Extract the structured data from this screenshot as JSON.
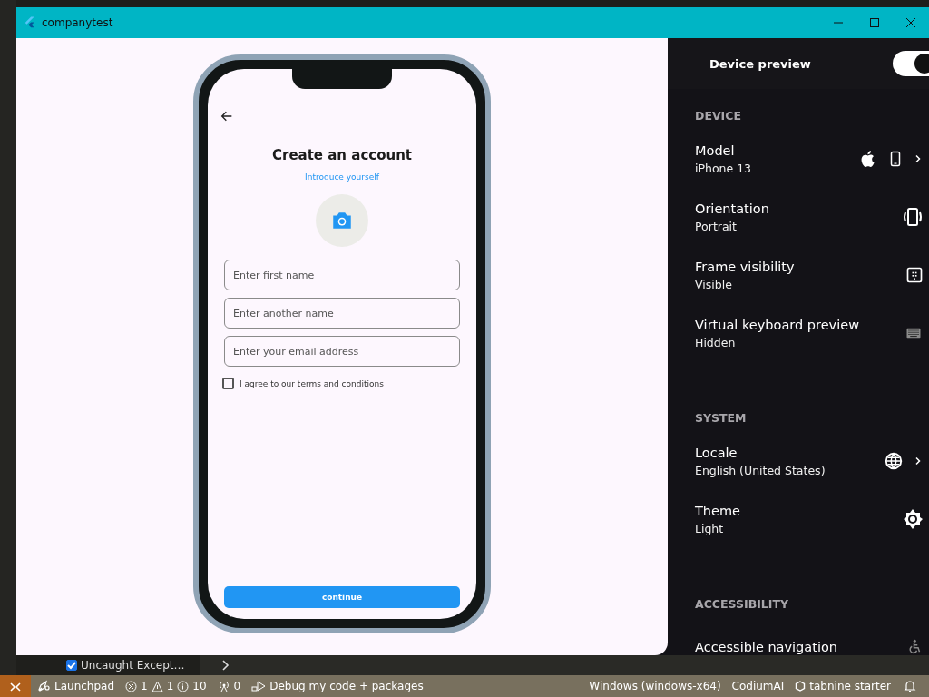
{
  "window": {
    "title": "companytest"
  },
  "phone_screen": {
    "title": "Create an account",
    "subtitle": "Introduce yourself",
    "fields": [
      {
        "placeholder": "Enter first name"
      },
      {
        "placeholder": "Enter another name"
      },
      {
        "placeholder": "Enter your email address"
      }
    ],
    "terms": {
      "label": "I agree to our terms and conditions",
      "checked": false
    },
    "button": "continue"
  },
  "device_preview": {
    "title": "Device preview",
    "toggle": {
      "on": true
    },
    "sections": [
      {
        "heading": "DEVICE",
        "items": [
          {
            "label": "Model",
            "value": "iPhone 13"
          },
          {
            "label": "Orientation",
            "value": "Portrait"
          },
          {
            "label": "Frame visibility",
            "value": "Visible"
          },
          {
            "label": "Virtual keyboard preview",
            "value": "Hidden"
          }
        ]
      },
      {
        "heading": "SYSTEM",
        "items": [
          {
            "label": "Locale",
            "value": "English (United States)"
          },
          {
            "label": "Theme",
            "value": "Light"
          }
        ]
      },
      {
        "heading": "ACCESSIBILITY",
        "items": [
          {
            "label": "Accessible navigation"
          }
        ]
      }
    ]
  },
  "debug_bar": {
    "exception": {
      "label": "Uncaught Except…",
      "checked": true
    }
  },
  "status_bar": {
    "left": [
      {
        "kind": "launchpad",
        "text": "Launchpad"
      },
      {
        "kind": "problems",
        "errors": "1",
        "warnings": "1",
        "info": "10"
      },
      {
        "kind": "ports",
        "text": "0"
      },
      {
        "kind": "debug",
        "text": "Debug my code + packages"
      }
    ],
    "right": [
      {
        "kind": "text",
        "text": "Windows (windows-x64)"
      },
      {
        "kind": "text",
        "text": "CodiumAI"
      },
      {
        "kind": "tabnine",
        "text": "tabnine starter"
      },
      {
        "kind": "bell"
      }
    ]
  }
}
